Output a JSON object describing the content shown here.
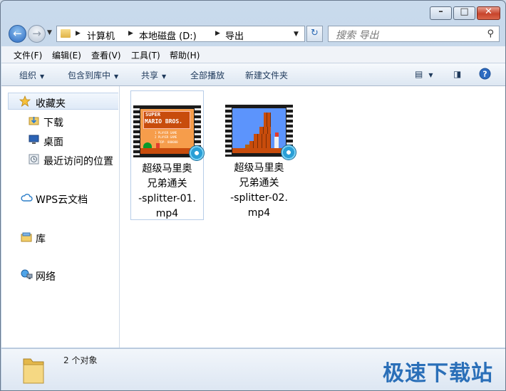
{
  "address": {
    "crumbs": [
      "计算机",
      "本地磁盘 (D:)",
      "导出"
    ]
  },
  "search": {
    "placeholder": "搜索 导出"
  },
  "menu": [
    "文件(F)",
    "编辑(E)",
    "查看(V)",
    "工具(T)",
    "帮助(H)"
  ],
  "toolbar": {
    "organize": "组织",
    "include_library": "包含到库中",
    "share": "共享",
    "play_all": "全部播放",
    "new_folder": "新建文件夹"
  },
  "nav": {
    "favorites": "收藏夹",
    "favorites_items": [
      "下载",
      "桌面",
      "最近访问的位置"
    ],
    "wps": "WPS云文档",
    "libraries": "库",
    "network": "网络"
  },
  "files": [
    {
      "name_line1": "超级马里奥",
      "name_line2": "兄弟通关",
      "name_line3": "-splitter-01.",
      "name_line4": "mp4",
      "selected": true
    },
    {
      "name_line1": "超级马里奥",
      "name_line2": "兄弟通关",
      "name_line3": "-splitter-02.",
      "name_line4": "mp4",
      "selected": false
    }
  ],
  "thumb1_text": {
    "line1": "SUPER",
    "line2": "MARIO BROS.",
    "line3": "1 PLAYER GAME",
    "line4": "2 PLAYER GAME",
    "line5": "TOP- 000000"
  },
  "status": {
    "count": "2 个对象"
  },
  "watermark": "极速下载站",
  "icons": [
    "back-arrow-icon",
    "forward-arrow-icon",
    "folder-icon",
    "refresh-icon",
    "search-icon",
    "star-icon",
    "download-folder-icon",
    "desktop-icon",
    "recent-places-icon",
    "cloud-icon",
    "library-icon",
    "network-icon",
    "video-icon",
    "view-icon",
    "preview-pane-icon",
    "help-icon"
  ]
}
